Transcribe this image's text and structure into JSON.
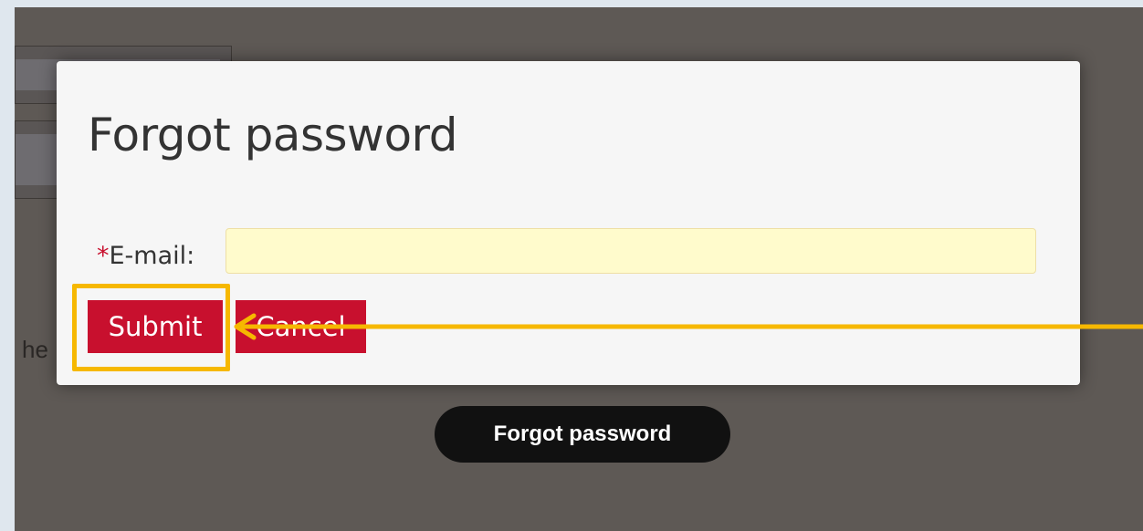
{
  "dialog": {
    "title": "Forgot password",
    "required_marker": "*",
    "email_label": "E-mail:",
    "email_value": "",
    "submit_label": "Submit",
    "cancel_label": "Cancel"
  },
  "background": {
    "partial_text": "he",
    "forgot_button_label": "Forgot password"
  },
  "annotation": {
    "highlight_color": "#f6b800",
    "target": "submit-button"
  },
  "colors": {
    "accent": "#c8102e",
    "input_bg": "#fffbcc",
    "overlay": "#5e5955"
  }
}
